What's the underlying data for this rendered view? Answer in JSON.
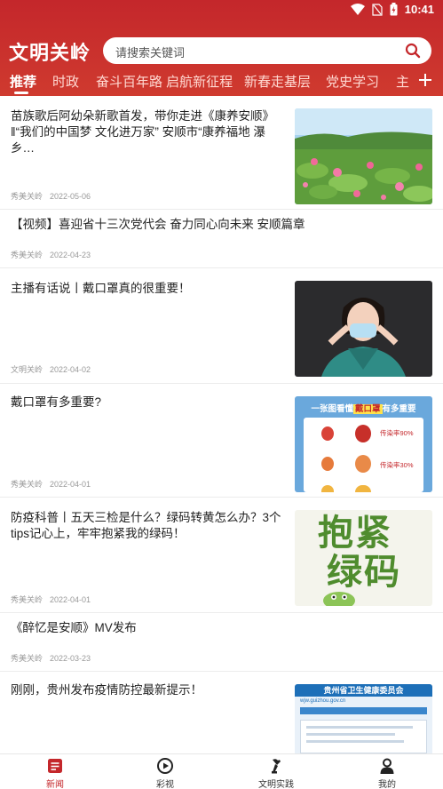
{
  "status_bar": {
    "time": "10:41"
  },
  "header": {
    "app_title": "文明关岭",
    "search_placeholder": "请搜索关键词"
  },
  "tabs": [
    "推荐",
    "时政",
    "奋斗百年路 启航新征程",
    "新春走基层",
    "党史学习",
    "主"
  ],
  "news": [
    {
      "title": "苗族歌后阿幼朵新歌首发，带你走进《康养安顺》‖“我们的中国梦 文化进万家” 安顺市“康养福地 瀑乡…",
      "source": "秀美关岭",
      "date": "2022-05-06",
      "thumb": "lotus-pond"
    },
    {
      "title": "【视频】喜迎省十三次党代会 奋力同心向未来 安顺篇章",
      "source": "秀美关岭",
      "date": "2022-04-23"
    },
    {
      "title": "主播有话说丨戴口罩真的很重要！",
      "source": "文明关岭",
      "date": "2022-04-02",
      "thumb": "anchor-mask"
    },
    {
      "title": "戴口罩有多重要?",
      "source": "秀美关岭",
      "date": "2022-04-01",
      "thumb": "mask-infographic",
      "thumb_text": {
        "heading_a": "一张图看懂",
        "heading_b": "戴口罩",
        "heading_c": "有多重要",
        "rate1": "传染率90%",
        "rate2": "传染率30%"
      }
    },
    {
      "title": "防疫科普丨五天三检是什么？绿码转黄怎么办？3个tips记心上，牢牢抱紧我的绿码！",
      "source": "秀美关岭",
      "date": "2022-04-01",
      "thumb": "green-code",
      "thumb_text": {
        "line1": "抱紧",
        "line2": "绿码"
      }
    },
    {
      "title": "《醉忆是安顺》MV发布",
      "source": "秀美关岭",
      "date": "2022-03-23"
    },
    {
      "title": "刚刚，贵州发布疫情防控最新提示！",
      "source": "",
      "date": "",
      "thumb": "gov-website",
      "thumb_text": {
        "banner": "贵州省卫生健康委员会",
        "url": "wjw.guizhou.gov.cn"
      }
    }
  ],
  "bottom_nav": [
    {
      "label": "新闻",
      "icon": "news-icon",
      "active": true
    },
    {
      "label": "彩视",
      "icon": "play-icon",
      "active": false
    },
    {
      "label": "文明实践",
      "icon": "torch-icon",
      "active": false
    },
    {
      "label": "我的",
      "icon": "user-icon",
      "active": false
    }
  ],
  "colors": {
    "brand_red": "#c4272b",
    "tab_inactive": "#ffd9d2"
  }
}
